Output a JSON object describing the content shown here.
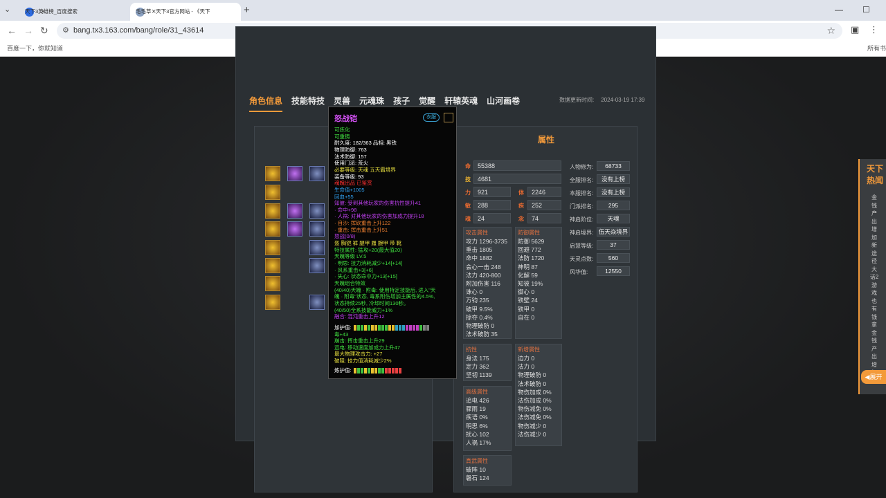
{
  "browser": {
    "tabs": [
      {
        "title": "天下3英雄榜_百度搜索",
        "close": "×"
      },
      {
        "title": "毛毛草 - 天下3官方网站 - 《天下",
        "close": "×"
      }
    ],
    "new_tab": "+",
    "url": "bang.tx3.163.com/bang/role/31_43614",
    "bookmarks": [
      "百度一下，你就知道",
      "所有书"
    ]
  },
  "page": {
    "tabs": [
      "角色信息",
      "技能特技",
      "灵兽",
      "元魂珠",
      "孩子",
      "觉醒",
      "轩辕英魂",
      "山河画卷"
    ],
    "update_label": "数据更新时间:",
    "update_time": "2024-03-19 17:39",
    "attr_title": "属性",
    "main_stats": [
      {
        "label": "命",
        "value": "55388",
        "color": "#e86a30"
      },
      {
        "label": "技",
        "value": "4681",
        "color": "#e8b030"
      }
    ],
    "pair_stats": [
      {
        "l1": "力",
        "v1": "921",
        "l2": "体",
        "v2": "2246"
      },
      {
        "l1": "敏",
        "v1": "288",
        "l2": "疾",
        "v2": "252"
      },
      {
        "l1": "魂",
        "v1": "24",
        "l2": "念",
        "v2": "74"
      }
    ],
    "right_stats": [
      {
        "label": "人物修为:",
        "value": "68733"
      },
      {
        "label": "全服排名:",
        "value": "没有上榜"
      },
      {
        "label": "本服排名:",
        "value": "没有上榜"
      },
      {
        "label": "门派排名:",
        "value": "295"
      },
      {
        "label": "神启阶位:",
        "value": "天魂"
      },
      {
        "label": "神启境界:",
        "value": "伍天焱境界"
      },
      {
        "label": "启慧等级:",
        "value": "37"
      },
      {
        "label": "天灵点数:",
        "value": "560"
      },
      {
        "label": "风华值:",
        "value": "12550"
      }
    ],
    "attack": {
      "title": "攻击属性",
      "rows": [
        "攻力 1296-3735",
        "重击 1805",
        "命中 1882",
        "会心一击 248",
        "法力 420-800",
        "附加伤害 116",
        "诛心 0",
        "万钧 235",
        "破甲 9.5%",
        "掠夺 0.4%",
        "物理破防 0",
        "法术破防 35"
      ]
    },
    "defense": {
      "title": "防御属性",
      "rows": [
        "防御 5629",
        "回避 772",
        "法防 1720",
        "神明 87",
        "化解 59",
        "知彼 19%",
        "御心 0",
        "铁壁 24",
        "铁甲 0",
        "自在 0"
      ]
    },
    "resist": {
      "title": "抗性",
      "rows": [
        "身法 175",
        "定力 362",
        "坚韧 1139"
      ]
    },
    "new_attr": {
      "title": "新增属性",
      "rows": [
        "边力 0",
        "法力 0",
        "物理破防 0",
        "法术破防 0",
        "物伤加成 0%",
        "法伤加成 0%",
        "物伤减免 0%",
        "法伤减免 0%",
        "物伤减少 0",
        "法伤减少 0"
      ]
    },
    "advanced": {
      "title": "高级属性",
      "rows": [
        "追电 426",
        "骤雨 19",
        "疾语 0%",
        "明思 6%",
        "扰心 102",
        "人祸 17%"
      ]
    },
    "real": {
      "title": "真武属性",
      "rows": [
        "破阵 10",
        "磐石 124"
      ]
    },
    "side_box": {
      "title": "天下热闻",
      "text": "金钱产出增加新途径大话2游戏也有钱拿金钱产出增加"
    },
    "expand": "展开"
  },
  "tooltip": {
    "name": "怒战铠",
    "badge": "衣服",
    "lines": [
      {
        "t": "可炼化",
        "c": "#40e040"
      },
      {
        "t": "可重铸",
        "c": "#40e040"
      },
      {
        "t": "耐久度: 182/363     品相: 黑铁",
        "c": "#ffffff"
      },
      {
        "t": "物理防御: 763",
        "c": "#ffffff"
      },
      {
        "t": "法术防御: 157",
        "c": "#ffffff"
      },
      {
        "t": "使用门派: 荒火",
        "c": "#ffffff"
      },
      {
        "t": "必要等级: 天魂 五天霸境界",
        "c": "#e8e040"
      },
      {
        "t": "装备等级: 93",
        "c": "#ffffff"
      },
      {
        "t": "魂魄出品 已鉴赏",
        "c": "#ff3030"
      },
      {
        "t": "生命值+1005",
        "c": "#30a0f0"
      },
      {
        "t": "回血+55",
        "c": "#30a0f0"
      },
      {
        "t": "知彼: 受到其他玩家的伤害抗性提升41",
        "c": "#c040f0"
      },
      {
        "t": " · 命中+98",
        "c": "#c040f0"
      },
      {
        "t": " · 人祸: 对其他玩家的伤害加成力提升18",
        "c": "#c040f0"
      },
      {
        "t": " · 自沙: 挥砍重击上升122",
        "c": "#f08030"
      },
      {
        "t": " · 重击: 挥击重击上升51",
        "c": "#f08030"
      },
      {
        "t": "怒战(0/8)",
        "c": "#c040f0"
      },
      {
        "t": "   盔 胸铠 裤 腿甲 履 腕甲 带 靴",
        "c": "#e8e040"
      },
      {
        "t": "   特技属性: 猛攻+20(最大值20)",
        "c": "#40e040"
      },
      {
        "t": "天魄等级 LV.5",
        "c": "#40e040"
      },
      {
        "t": " · 明思: 技力消耗减少+14[+14]",
        "c": "#40e040"
      },
      {
        "t": " · 风系重击+3[+6]",
        "c": "#40e040"
      },
      {
        "t": " · 失心: 状态命中力+13[+15]",
        "c": "#40e040"
      },
      {
        "t": "天魄组合特效",
        "c": "#40e040"
      },
      {
        "t": "(40/40)天魄 · 附毒: 使用特定技能后, 进入\"天",
        "c": "#40e040"
      },
      {
        "t": "魄 · 附毒\"状态, 毒系附伤增加主属性的4.5%,",
        "c": "#40e040"
      },
      {
        "t": "状态持续25秒, 冷却时间130秒。",
        "c": "#40e040"
      },
      {
        "t": "(40/50)全系技能威力+1%",
        "c": "#40e040"
      },
      {
        "t": "融合: 混沌重击上升12",
        "c": "#c040f0"
      },
      {
        "t": "加护值:",
        "c": "#ffffff"
      },
      {
        "t": "毒+43",
        "c": "#40e040"
      },
      {
        "t": "崩击: 挥击重击上升29",
        "c": "#40e040"
      },
      {
        "t": "迅电: 移动速度加成力上升47",
        "c": "#40e040"
      },
      {
        "t": "最大物理攻击力: +27",
        "c": "#e8e040"
      },
      {
        "t": "破阻: 技力值消耗减少2%",
        "c": "#e8e040"
      },
      {
        "t": "炼护值:",
        "c": "#ffffff"
      }
    ]
  }
}
